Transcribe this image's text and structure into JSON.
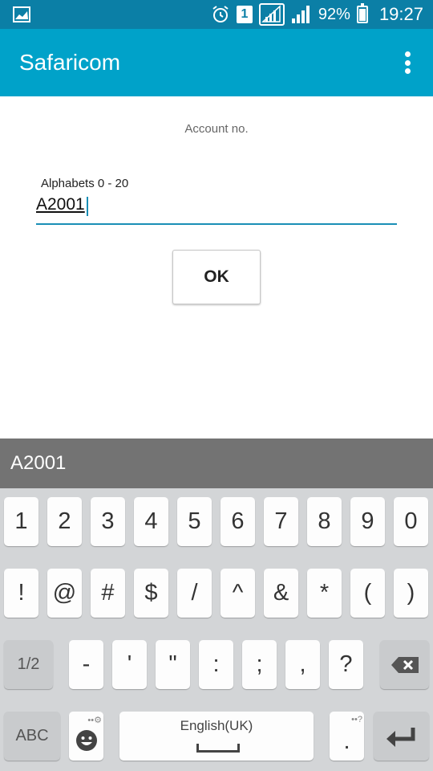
{
  "status_bar": {
    "battery": "92%",
    "battery_level": 0.92,
    "sim": "1",
    "time": "19:27",
    "icons": [
      "gallery-icon",
      "alarm-icon",
      "sim-icon",
      "signal-icon",
      "signal-icon",
      "battery-icon"
    ]
  },
  "app_bar": {
    "title": "Safaricom",
    "menu_icon": "more-vert-icon"
  },
  "form": {
    "account_label": "Account no.",
    "field_hint": "Alphabets 0 - 20",
    "field_value": "A2001",
    "ok_label": "OK"
  },
  "suggestion": {
    "text": "A2001"
  },
  "keyboard": {
    "row1": [
      "1",
      "2",
      "3",
      "4",
      "5",
      "6",
      "7",
      "8",
      "9",
      "0"
    ],
    "row2": [
      "!",
      "@",
      "#",
      "$",
      "/",
      "^",
      "&",
      "*",
      "(",
      ")"
    ],
    "row3_left": "1/2",
    "row3": [
      "-",
      "'",
      "\"",
      ":",
      ";",
      ",",
      "?"
    ],
    "row4_left": "ABC",
    "space_label": "English(UK)",
    "period_key": ".",
    "period_sublabel": "••?",
    "emoji_sublabel": "••⚙"
  },
  "colors": {
    "status_bar": "#0b7fa6",
    "app_bar": "#00a2c9",
    "accent": "#1a8fb6",
    "suggestion_bar": "#737373",
    "keyboard_bg": "#d3d5d7"
  }
}
